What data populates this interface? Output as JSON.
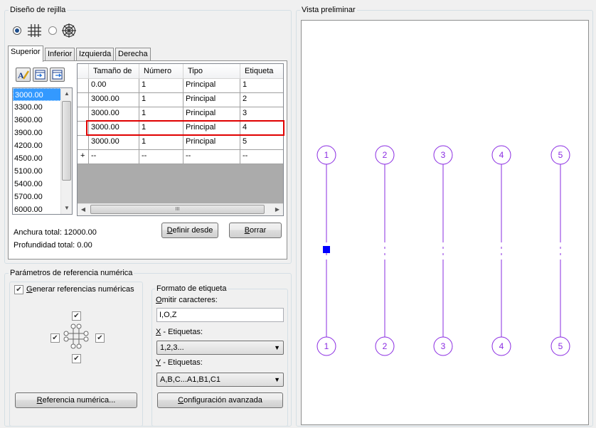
{
  "grid_design": {
    "title": "Diseño de rejilla",
    "radio_options": [
      {
        "icon": "orthogonal-grid-icon",
        "selected": true
      },
      {
        "icon": "radial-grid-icon",
        "selected": false
      }
    ],
    "tabs": [
      "Superior",
      "Inferior",
      "Izquierda",
      "Derecha"
    ],
    "active_tab": "Superior",
    "toolbar_icons": [
      "edit-spacing-icon",
      "import-spacing-icon",
      "export-spacing-icon"
    ],
    "spacing_list": [
      "3000.00",
      "3300.00",
      "3600.00",
      "3900.00",
      "4200.00",
      "4500.00",
      "5100.00",
      "5400.00",
      "5700.00",
      "6000.00"
    ],
    "selected_spacing": "3000.00",
    "table": {
      "columns": [
        "Tamaño de",
        "Número",
        "Tipo",
        "Etiqueta"
      ],
      "rows": [
        {
          "size": "0.00",
          "number": "1",
          "type": "Principal",
          "label": "1"
        },
        {
          "size": "3000.00",
          "number": "1",
          "type": "Principal",
          "label": "2"
        },
        {
          "size": "3000.00",
          "number": "1",
          "type": "Principal",
          "label": "3"
        },
        {
          "size": "3000.00",
          "number": "1",
          "type": "Principal",
          "label": "4"
        },
        {
          "size": "3000.00",
          "number": "1",
          "type": "Principal",
          "label": "5"
        }
      ],
      "new_row": {
        "marker": "+",
        "size": "--",
        "number": "--",
        "type": "--",
        "label": "--"
      },
      "hscroll_thumb": "III"
    },
    "total_width": "Anchura total: 12000.00",
    "total_depth": "Profundidad total: 0.00",
    "define_from_prefix": "D",
    "define_from_rest": "efinir desde",
    "delete_prefix": "B",
    "delete_rest": "orrar"
  },
  "numeric_ref": {
    "title": "Parámetros de referencia numérica",
    "generate_prefix": "G",
    "generate_rest": "enerar referencias numéricas",
    "generate_checked": true,
    "button_prefix": "R",
    "button_rest": "eferencia numérica..."
  },
  "label_format": {
    "title": "Formato de etiqueta",
    "omit_prefix": "O",
    "omit_rest": "mitir caracteres:",
    "omit_value": "I,O,Z",
    "x_prefix": "X",
    "x_rest": " - Etiquetas:",
    "x_value": "1,2,3...",
    "y_prefix": "Y",
    "y_rest": " - Etiquetas:",
    "y_value": "A,B,C...A1,B1,C1",
    "advanced_prefix": "C",
    "advanced_rest": "onfiguración avanzada"
  },
  "preview": {
    "title": "Vista preliminar",
    "labels_top": [
      "1",
      "2",
      "3",
      "4",
      "5"
    ],
    "labels_bottom": [
      "1",
      "2",
      "3",
      "4",
      "5"
    ],
    "line_color": "#8a2be2",
    "marker_color": "#0000ff"
  },
  "highlight_color": "#e00000"
}
